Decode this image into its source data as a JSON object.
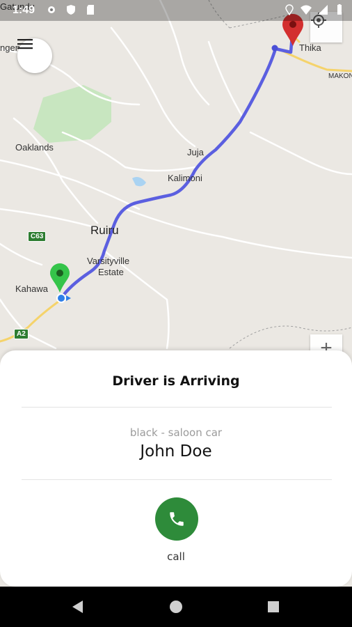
{
  "status_bar": {
    "time": "1:49",
    "left_icons": [
      "settings-icon",
      "shield-icon",
      "sd-card-icon"
    ],
    "right_icons": [
      "location-icon",
      "wifi-icon",
      "cell-signal-icon",
      "battery-icon"
    ]
  },
  "map": {
    "labels": {
      "satundu": "Gatundu",
      "ngendu": "ngendu",
      "thika": "Thika",
      "makon": "MAKON",
      "oaklands": "Oaklands",
      "juja": "Juja",
      "kalimoni": "Kalimoni",
      "ruiru": "Ruiru",
      "varsityville": "Varsityville",
      "estate": "Estate",
      "kahawa": "Kahawa"
    },
    "shields": {
      "c63": "C63",
      "a2": "A2"
    },
    "route_color": "#5b5fe0",
    "origin_pin_color": "#35c44a",
    "destination_pin_color": "#d32f2f",
    "zoom_in_label": "+"
  },
  "sheet": {
    "title": "Driver is Arriving",
    "car_description": "black - saloon car",
    "driver_name": "John Doe",
    "call_label": "call",
    "call_color": "#2e8b3a"
  },
  "nav": {
    "icons": [
      "back-icon",
      "home-icon",
      "recents-icon"
    ]
  }
}
